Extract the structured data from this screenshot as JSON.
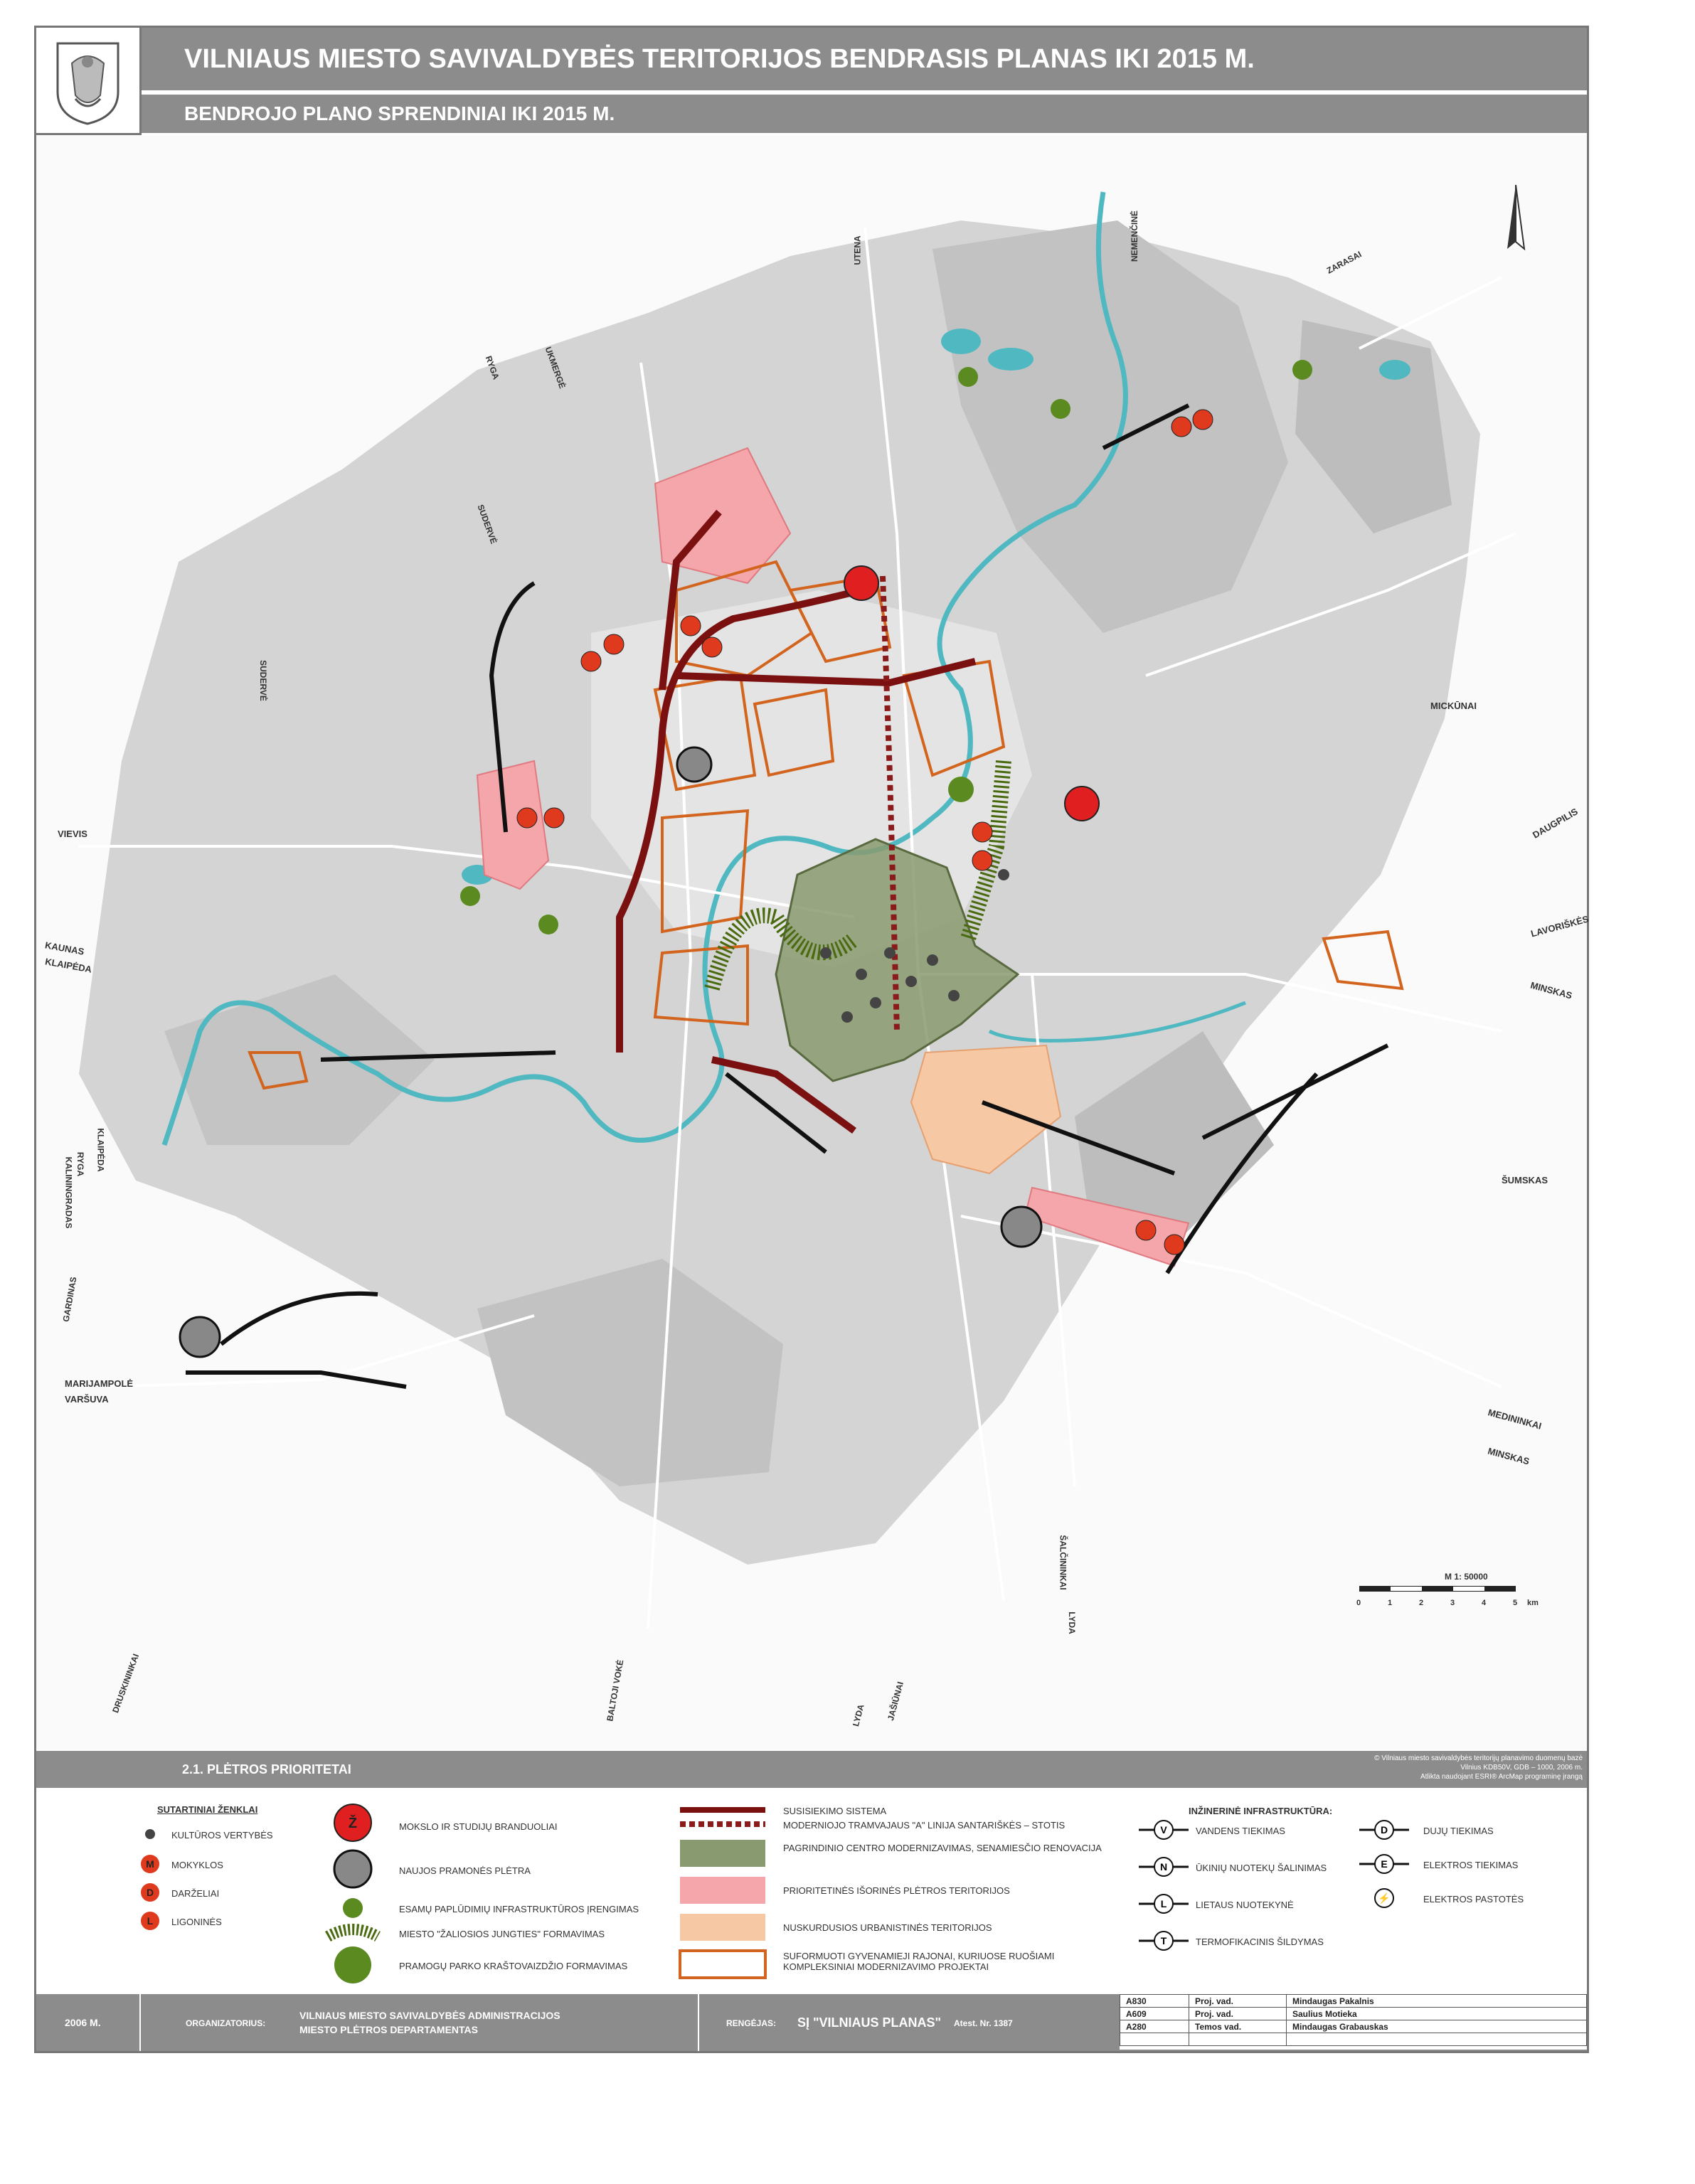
{
  "header": {
    "title": "VILNIAUS MIESTO SAVIVALDYBĖS TERITORIJOS  BENDRASIS PLANAS IKI 2015 M.",
    "subtitle": "BENDROJO PLANO SPRENDINIAI IKI 2015 M."
  },
  "map": {
    "direction_labels": {
      "utena": "UTENA",
      "nemencine": "NEMENČINĖ",
      "zarasai": "ZARASAI",
      "ukmerge": "UKMERGĖ",
      "ryga_n": "RYGA",
      "suderve_n": "SUDERVĖ",
      "suderve_w": "SUDERVĖ",
      "vievis": "VIEVIS",
      "kaunas": "KAUNAS",
      "klaipeda_w": "KLAIPĖDA",
      "klaipeda_sw": "KLAIPĖDA",
      "ryga_sw": "RYGA",
      "kaliningradas": "KALININGRADAS",
      "gardinas": "GARDINAS",
      "marijampole": "MARIJAMPOLĖ",
      "varsuva": "VARŠUVA",
      "druskininkai": "DRUSKININKAI",
      "baltoji_voke": "BALTOJI VOKĖ",
      "lyda_s": "LYDA",
      "jasiunai": "JAŠIŪNAI",
      "salcininkai": "ŠALČININKAI",
      "lyda_se": "LYDA",
      "mickunai": "MICKŪNAI",
      "daugpilis": "DAUGPILIS",
      "lavoriskes": "LAVORIŠKĖS",
      "minskas_e": "MINSKAS",
      "sumskas": "ŠUMSKAS",
      "medininkai": "MEDININKAI",
      "minskas_se": "MINSKAS"
    },
    "scale": {
      "label": "M  1: 50000",
      "ticks": [
        "0",
        "1",
        "2",
        "3",
        "4",
        "5"
      ],
      "unit": "km"
    }
  },
  "section": {
    "number_title": "2.1.    PLĖTROS PRIORITETAI",
    "copyright_1": "© Vilniaus miesto savivaldybės teritorijų planavimo duomenų bazė",
    "copyright_2": "Vilnius KDB50V, GDB – 1000, 2006 m.",
    "copyright_3": "Atlikta naudojant ESRI® ArcMap programinę įrangą"
  },
  "legend": {
    "heading": "SUTARTINIAI ŽENKLAI",
    "symbols": [
      {
        "letter": "",
        "label": "KULTŪROS VERTYBĖS"
      },
      {
        "letter": "M",
        "label": "MOKYKLOS"
      },
      {
        "letter": "D",
        "label": "DARŽELIAI"
      },
      {
        "letter": "L",
        "label": "LIGONINĖS"
      }
    ],
    "column2": [
      {
        "label": "MOKSLO IR STUDIJŲ BRANDUOLIAI",
        "letter": "Ž"
      },
      {
        "label": "NAUJOS PRAMONĖS PLĖTRA"
      },
      {
        "label": "ESAMŲ PAPLŪDIMIŲ INFRASTRUKTŪROS ĮRENGIMAS"
      },
      {
        "label": "MIESTO \"ŽALIOSIOS JUNGTIES\" FORMAVIMAS"
      },
      {
        "label": "PRAMOGŲ PARKO KRAŠTOVAIZDŽIO FORMAVIMAS"
      }
    ],
    "column3": [
      {
        "label": "SUSISIEKIMO SISTEMA"
      },
      {
        "label": "MODERNIOJO TRAMVAJAUS \"A\" LINIJA SANTARIŠKĖS – STOTIS"
      },
      {
        "label": "PAGRINDINIO CENTRO MODERNIZAVIMAS, SENAMIESČIO RENOVACIJA"
      },
      {
        "label": "PRIORITETINĖS IŠORINĖS PLĖTROS TERITORIJOS"
      },
      {
        "label": "NUSKURDUSIOS URBANISTINĖS TERITORIJOS"
      },
      {
        "label": "SUFORMUOTI GYVENAMIEJI RAJONAI, KURIUOSE RUOŠIAMI KOMPLEKSINIAI MODERNIZAVIMO PROJEKTAI"
      }
    ],
    "infra_heading": "INŽINERINĖ INFRASTRUKTŪRA:",
    "infra": [
      {
        "letter": "V",
        "label": "VANDENS TIEKIMAS"
      },
      {
        "letter": "N",
        "label": "ŪKINIŲ NUOTEKŲ ŠALINIMAS"
      },
      {
        "letter": "L",
        "label": "LIETAUS NUOTEKYNĖ"
      },
      {
        "letter": "T",
        "label": "TERMOFIKACINIS ŠILDYMAS"
      },
      {
        "letter": "D",
        "label": "DUJŲ TIEKIMAS"
      },
      {
        "letter": "E",
        "label": "ELEKTROS TIEKIMAS"
      },
      {
        "letter": "⚡",
        "label": "ELEKTROS PASTOTĖS"
      }
    ]
  },
  "footer": {
    "year": "2006 M.",
    "organizer_label": "ORGANIZATORIUS:",
    "organizer_1": "VILNIAUS MIESTO SAVIVALDYBĖS ADMINISTRACIJOS",
    "organizer_2": "MIESTO PLĖTROS DEPARTAMENTAS",
    "developer_label": "RENGĖJAS:",
    "developer": "SĮ \"VILNIAUS PLANAS\"",
    "certificate": "Atest. Nr. 1387",
    "credits": [
      {
        "code": "A830",
        "role": "Proj. vad.",
        "name": "Mindaugas Pakalnis"
      },
      {
        "code": "A609",
        "role": "Proj. vad.",
        "name": "Saulius Motieka"
      },
      {
        "code": "A280",
        "role": "Temos vad.",
        "name": "Mindaugas Grabauskas"
      }
    ]
  },
  "colors": {
    "transport": "#7a1010",
    "tram": "#8b1a1a",
    "center": "#8a9a70",
    "priority": "#f4a6aa",
    "deprived": "#f6c8a4",
    "districts": "#d2641e",
    "school": "#e03a1e",
    "green_link": "#4a6a10",
    "river": "#4fb8c0",
    "urban": "#c8c8c8"
  }
}
